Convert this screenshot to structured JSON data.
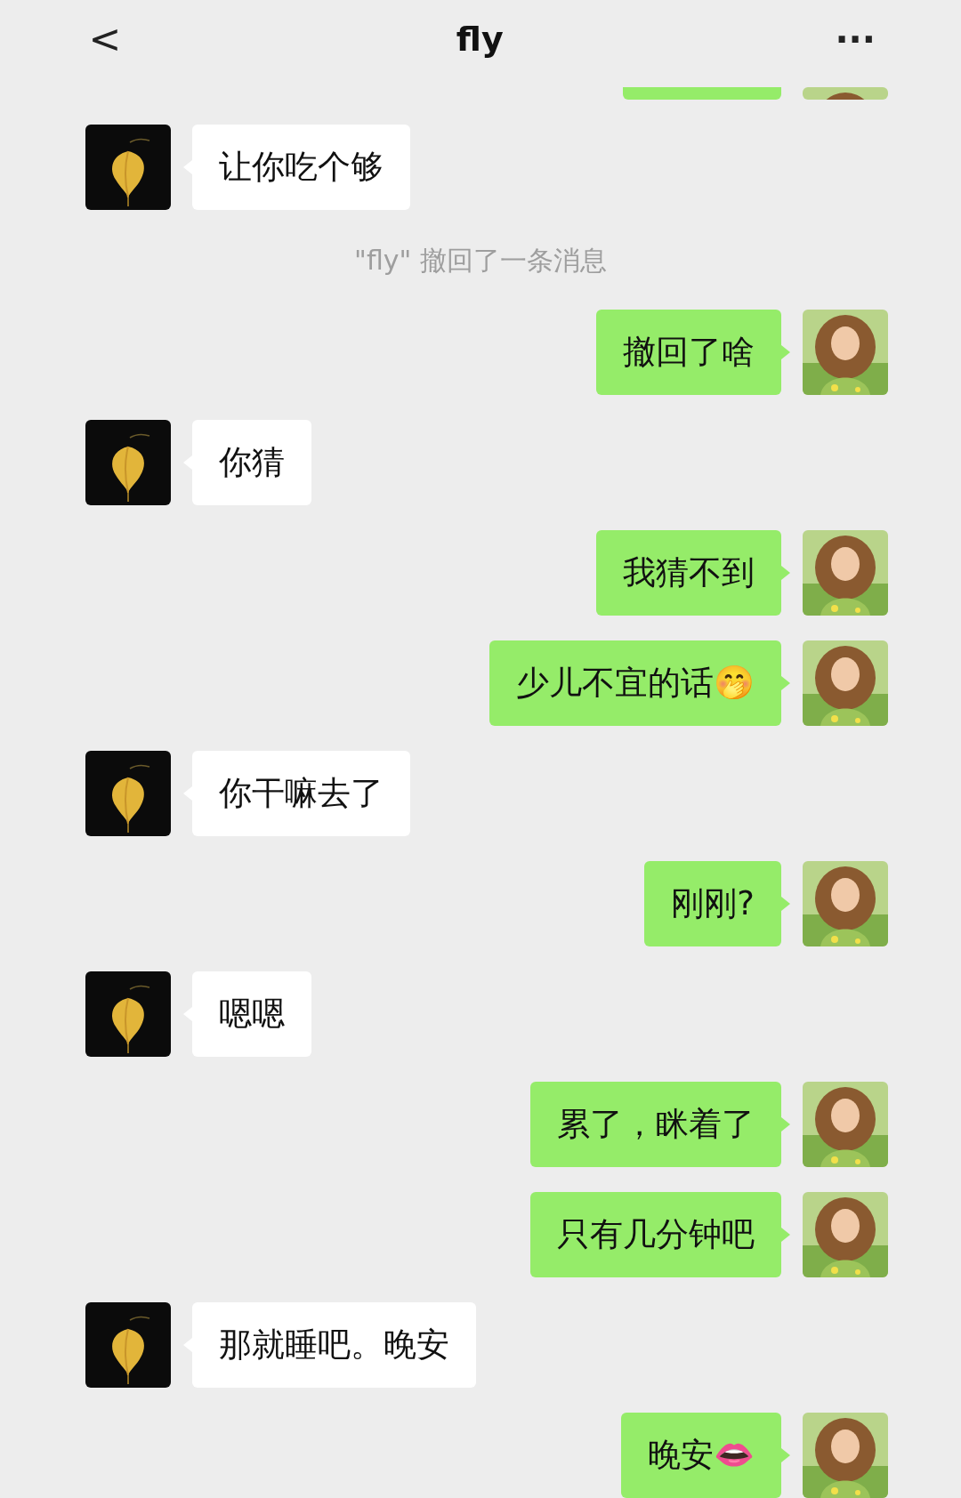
{
  "header": {
    "back": "<",
    "title": "fly",
    "more": "···"
  },
  "messages": [
    {
      "kind": "cut",
      "outgoing": true
    },
    {
      "kind": "message",
      "outgoing": false,
      "text": "让你吃个够"
    },
    {
      "kind": "system",
      "text": "\"fly\" 撤回了一条消息"
    },
    {
      "kind": "message",
      "outgoing": true,
      "text": "撤回了啥"
    },
    {
      "kind": "message",
      "outgoing": false,
      "text": "你猜"
    },
    {
      "kind": "message",
      "outgoing": true,
      "text": "我猜不到"
    },
    {
      "kind": "message",
      "outgoing": true,
      "text": "少儿不宜的话🤭"
    },
    {
      "kind": "message",
      "outgoing": false,
      "text": "你干嘛去了"
    },
    {
      "kind": "message",
      "outgoing": true,
      "text": "刚刚?"
    },
    {
      "kind": "message",
      "outgoing": false,
      "text": "嗯嗯"
    },
    {
      "kind": "message",
      "outgoing": true,
      "text": "累了，眯着了"
    },
    {
      "kind": "message",
      "outgoing": true,
      "text": "只有几分钟吧"
    },
    {
      "kind": "message",
      "outgoing": false,
      "text": "那就睡吧。晚安"
    },
    {
      "kind": "message",
      "outgoing": true,
      "text": "晚安👄"
    }
  ]
}
